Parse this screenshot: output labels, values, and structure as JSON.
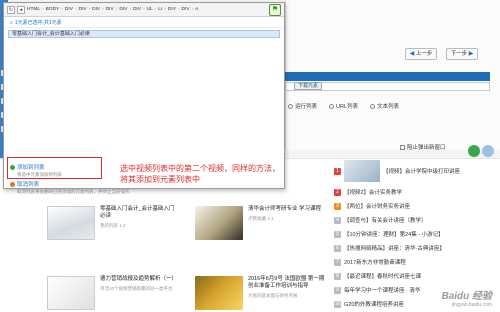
{
  "popup": {
    "toolbar_icons": [
      "refresh-icon",
      "back-icon"
    ],
    "breadcrumb": [
      "HTML",
      "BODY",
      "DIV",
      "DIV",
      "DIV",
      "DIV",
      "DIV",
      "DIV",
      "UL",
      "LI",
      "DIV",
      "DIV",
      "A"
    ],
    "search_text": "1元素已选中,共1元素",
    "selected_item": "零基础入门会计_会计基础入门必读",
    "actions": [
      {
        "label": "添加到列表",
        "sub": "将选中元素添加到列表",
        "icon": "green-dot-icon"
      },
      {
        "label": "取消列表",
        "sub": "取消列表将会删除已经添加的元素列表，并停止当前操作",
        "icon": "orange-dot-icon"
      }
    ]
  },
  "annotation": {
    "line1": "选中视频列表中的第二个视频，同样的方法，",
    "line2": "将其添加到元素列表中"
  },
  "right_panel": {
    "prev_button": "上一步",
    "next_button": "下一步",
    "download_button": "下载元素",
    "radios": [
      "运行列表",
      "URL列表",
      "文本列表"
    ],
    "checkbox_label": "阻止弹出新窗口"
  },
  "articles": [
    {
      "title": "零基础入门会计_会计基础入门必读",
      "meta": "我的列表    1  2",
      "thumb": "thumb-1"
    },
    {
      "title": "清华会计师考研专业 学习课程",
      "meta": "点赞收藏    4  3",
      "thumb": "thumb-2"
    },
    {
      "title": "德力营销战报及趋势解析（一）",
      "meta": "月活10个视频营销跑赢的同一类平台",
      "thumb": "thumb-3"
    },
    {
      "title": "2016年6月9号 法国欧盟 第一期创业准备工作培训与指导",
      "meta": "大盘的基本面与财务月报",
      "thumb": "thumb-4"
    }
  ],
  "ranking": [
    {
      "num": "1",
      "text": "【视频】会计学院中级打印讲座"
    },
    {
      "num": "2",
      "text": "【视频2】会计实务教学"
    },
    {
      "num": "3",
      "text": "【两位】会计财务实务讲座"
    },
    {
      "num": "4",
      "text": "【调查与】有关会计讲座（教学）"
    },
    {
      "num": "5",
      "text": "【10分钟讲座：理财】第24集 - 小游记】"
    },
    {
      "num": "6",
      "text": "【热搜网络精品】讲座：清华·古典讲座】"
    },
    {
      "num": "7",
      "text": "2017新东方非常勤奋课程"
    },
    {
      "num": "8",
      "text": "【最近课程】春秋时代讲座七课"
    },
    {
      "num": "9",
      "text": "每年学习中一个课程讲座 · 清华"
    },
    {
      "num": "10",
      "text": "G20的外教课程培养讲座"
    }
  ],
  "watermark": {
    "line1": "Baidu 经验",
    "line2": "jingyan.baidu.com"
  }
}
